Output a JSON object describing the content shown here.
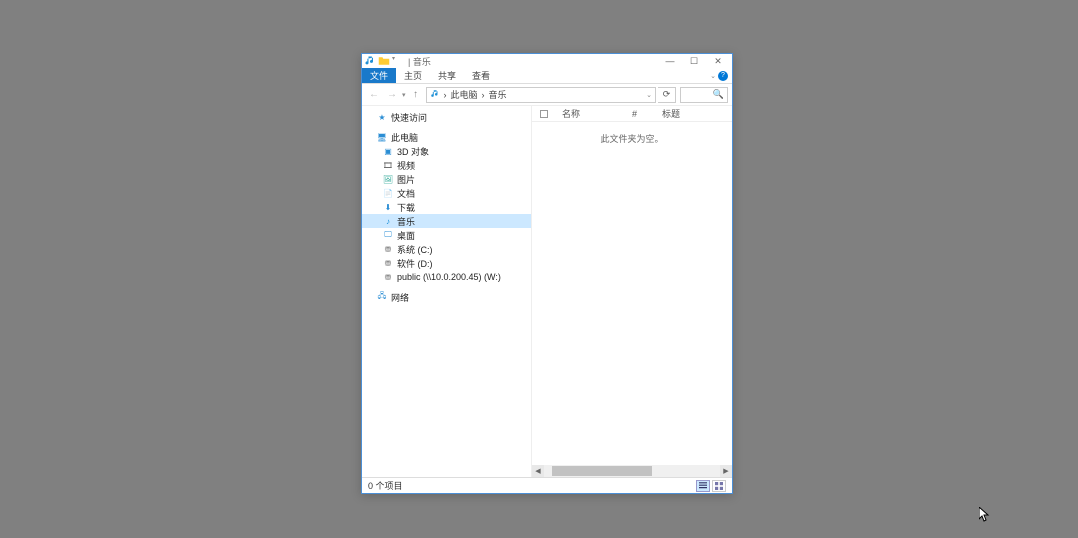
{
  "title": "音乐",
  "ribbon": {
    "file": "文件",
    "home": "主页",
    "share": "共享",
    "view": "查看"
  },
  "nav": {
    "back": "←",
    "forward": "→",
    "up": "↑"
  },
  "breadcrumb": {
    "root": "此电脑",
    "sep": "›",
    "leaf": "音乐"
  },
  "refresh_icon": "⟳",
  "search_icon": "🔍",
  "tree": {
    "quick_access": "快速访问",
    "this_pc": "此电脑",
    "objects3d": "3D 对象",
    "videos": "视频",
    "pictures": "图片",
    "documents": "文档",
    "downloads": "下载",
    "music": "音乐",
    "desktop": "桌面",
    "system_c": "系统 (C:)",
    "software_d": "软件 (D:)",
    "public_w": "public (\\\\10.0.200.45) (W:)",
    "network": "网络"
  },
  "columns": {
    "name": "名称",
    "number": "#",
    "title_col": "标题"
  },
  "empty_msg": "此文件夹为空。",
  "status": "0 个项目",
  "winbtns": {
    "min": "—",
    "max": "☐",
    "close": "✕"
  },
  "help": "?",
  "expand_chevron": "⌄"
}
